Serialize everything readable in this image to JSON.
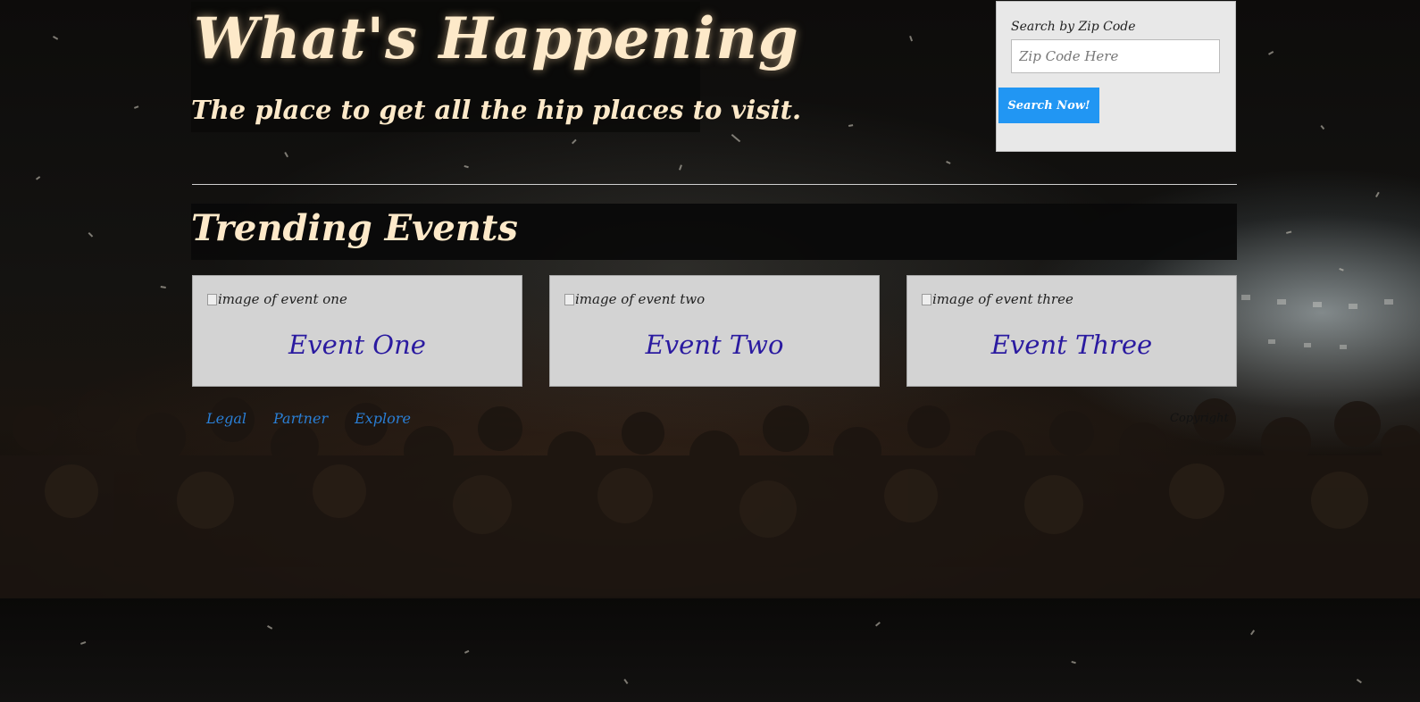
{
  "header": {
    "title": "What's Happening",
    "tagline": "The place to get all the hip places to visit."
  },
  "search": {
    "label": "Search by Zip Code",
    "placeholder": "Zip Code Here",
    "value": "",
    "button_label": "Search Now!"
  },
  "trending": {
    "heading": "Trending Events",
    "events": [
      {
        "image_alt": "image of event one",
        "name": "Event One"
      },
      {
        "image_alt": "image of event two",
        "name": "Event Two"
      },
      {
        "image_alt": "image of event three",
        "name": "Event Three"
      }
    ]
  },
  "footer": {
    "links": [
      "Legal",
      "Partner",
      "Explore"
    ],
    "copyright": "Copyright"
  },
  "colors": {
    "title_text": "#fde9c9",
    "button_blue": "#2196f3",
    "event_name": "#2a1aa0",
    "link_blue": "#2a7fd6",
    "card_bg": "#d3d3d3",
    "search_panel_bg": "#e8e8e8"
  }
}
